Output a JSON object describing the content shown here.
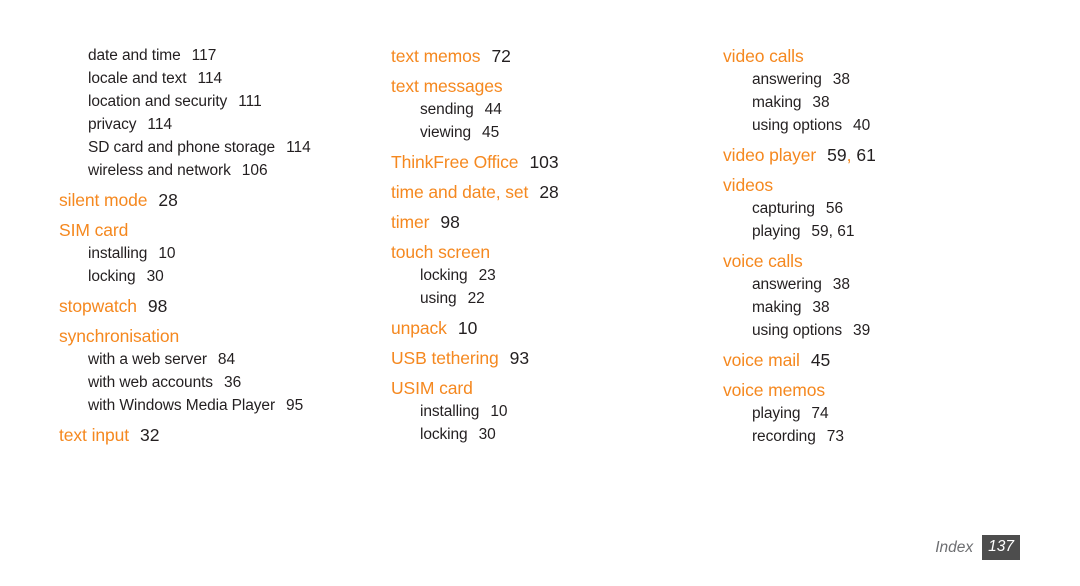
{
  "document": {
    "type": "index-page",
    "colors": {
      "heading": "#F5881F",
      "body_text": "#231F20",
      "footer_label": "#6D6E71",
      "footer_badge_bg": "#4D4D4D",
      "page_background": "#FFFFFF"
    }
  },
  "footer": {
    "label": "Index",
    "page_number": "137"
  },
  "columns": [
    {
      "id": "column-1",
      "groups": [
        {
          "heading": null,
          "entries": [
            {
              "label": "date and time",
              "page": "117"
            },
            {
              "label": "locale and text",
              "page": "114"
            },
            {
              "label": "location and security",
              "page": "111"
            },
            {
              "label": "privacy",
              "page": "114"
            },
            {
              "label": "SD card and phone storage",
              "page": "114"
            },
            {
              "label": "wireless and network",
              "page": "106"
            }
          ]
        },
        {
          "heading": {
            "label": "silent mode",
            "page": "28"
          },
          "entries": []
        },
        {
          "heading": {
            "label": "SIM card",
            "page": ""
          },
          "entries": [
            {
              "label": "installing",
              "page": "10"
            },
            {
              "label": "locking",
              "page": "30"
            }
          ]
        },
        {
          "heading": {
            "label": "stopwatch",
            "page": "98"
          },
          "entries": []
        },
        {
          "heading": {
            "label": "synchronisation",
            "page": ""
          },
          "entries": [
            {
              "label": "with a web server",
              "page": "84"
            },
            {
              "label": "with web accounts",
              "page": "36"
            },
            {
              "label": "with Windows Media Player",
              "page": "95"
            }
          ]
        },
        {
          "heading": {
            "label": "text input",
            "page": "32"
          },
          "entries": []
        }
      ]
    },
    {
      "id": "column-2",
      "groups": [
        {
          "heading": {
            "label": "text memos",
            "page": "72"
          },
          "entries": []
        },
        {
          "heading": {
            "label": "text messages",
            "page": ""
          },
          "entries": [
            {
              "label": "sending",
              "page": "44"
            },
            {
              "label": "viewing",
              "page": "45"
            }
          ]
        },
        {
          "heading": {
            "label": "ThinkFree Office",
            "page": "103"
          },
          "entries": []
        },
        {
          "heading": {
            "label": "time and date, set",
            "page": "28"
          },
          "entries": []
        },
        {
          "heading": {
            "label": "timer",
            "page": "98"
          },
          "entries": []
        },
        {
          "heading": {
            "label": "touch screen",
            "page": ""
          },
          "entries": [
            {
              "label": "locking",
              "page": "23"
            },
            {
              "label": "using",
              "page": "22"
            }
          ]
        },
        {
          "heading": {
            "label": "unpack",
            "page": "10"
          },
          "entries": []
        },
        {
          "heading": {
            "label": "USB tethering",
            "page": "93"
          },
          "entries": []
        },
        {
          "heading": {
            "label": "USIM card",
            "page": ""
          },
          "entries": [
            {
              "label": "installing",
              "page": "10"
            },
            {
              "label": "locking",
              "page": "30"
            }
          ]
        }
      ]
    },
    {
      "id": "column-3",
      "groups": [
        {
          "heading": {
            "label": "video calls",
            "page": ""
          },
          "entries": [
            {
              "label": "answering",
              "page": "38"
            },
            {
              "label": "making",
              "page": "38"
            },
            {
              "label": "using options",
              "page": "40"
            }
          ]
        },
        {
          "heading": {
            "label": "video player",
            "page": "59, 61",
            "accent_comma": true
          },
          "entries": []
        },
        {
          "heading": {
            "label": "videos",
            "page": ""
          },
          "entries": [
            {
              "label": "capturing",
              "page": "56"
            },
            {
              "label": "playing",
              "page": "59, 61"
            }
          ]
        },
        {
          "heading": {
            "label": "voice calls",
            "page": ""
          },
          "entries": [
            {
              "label": "answering",
              "page": "38"
            },
            {
              "label": "making",
              "page": "38"
            },
            {
              "label": "using options",
              "page": "39"
            }
          ]
        },
        {
          "heading": {
            "label": "voice mail",
            "page": "45"
          },
          "entries": []
        },
        {
          "heading": {
            "label": "voice memos",
            "page": ""
          },
          "entries": [
            {
              "label": "playing",
              "page": "74"
            },
            {
              "label": "recording",
              "page": "73"
            }
          ]
        }
      ]
    }
  ]
}
